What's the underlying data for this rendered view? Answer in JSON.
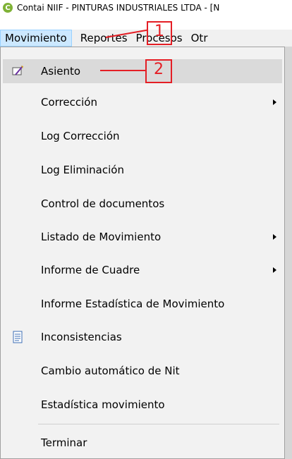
{
  "window": {
    "title": "Contai NIIF - PINTURAS INDUSTRIALES LTDA - [N",
    "app_icon": "contai-app-icon",
    "app_icon_letter": "C"
  },
  "menubar": {
    "items": [
      {
        "label": "Movimiento"
      },
      {
        "label": "Reportes"
      },
      {
        "label": "Procesos"
      },
      {
        "label": "Otr"
      }
    ]
  },
  "dropdown": {
    "items": [
      {
        "label": "Asiento",
        "has_submenu": false,
        "icon": "journal-entry-icon"
      },
      {
        "label": "Corrección",
        "has_submenu": true
      },
      {
        "label": "Log Corrección",
        "has_submenu": false
      },
      {
        "label": "Log Eliminación",
        "has_submenu": false
      },
      {
        "label": "Control de documentos",
        "has_submenu": false
      },
      {
        "label": "Listado de Movimiento",
        "has_submenu": true
      },
      {
        "label": "Informe de Cuadre",
        "has_submenu": true
      },
      {
        "label": "Informe Estadística de Movimiento",
        "has_submenu": false
      },
      {
        "label": "Inconsistencias",
        "has_submenu": false,
        "icon": "document-icon"
      },
      {
        "label": "Cambio automático de Nit",
        "has_submenu": false
      },
      {
        "label": "Estadística movimiento",
        "has_submenu": false
      },
      {
        "label": "Terminar",
        "has_submenu": false
      }
    ]
  },
  "annotations": {
    "callout_1": "1",
    "callout_2": "2",
    "color": "#e41e25"
  }
}
